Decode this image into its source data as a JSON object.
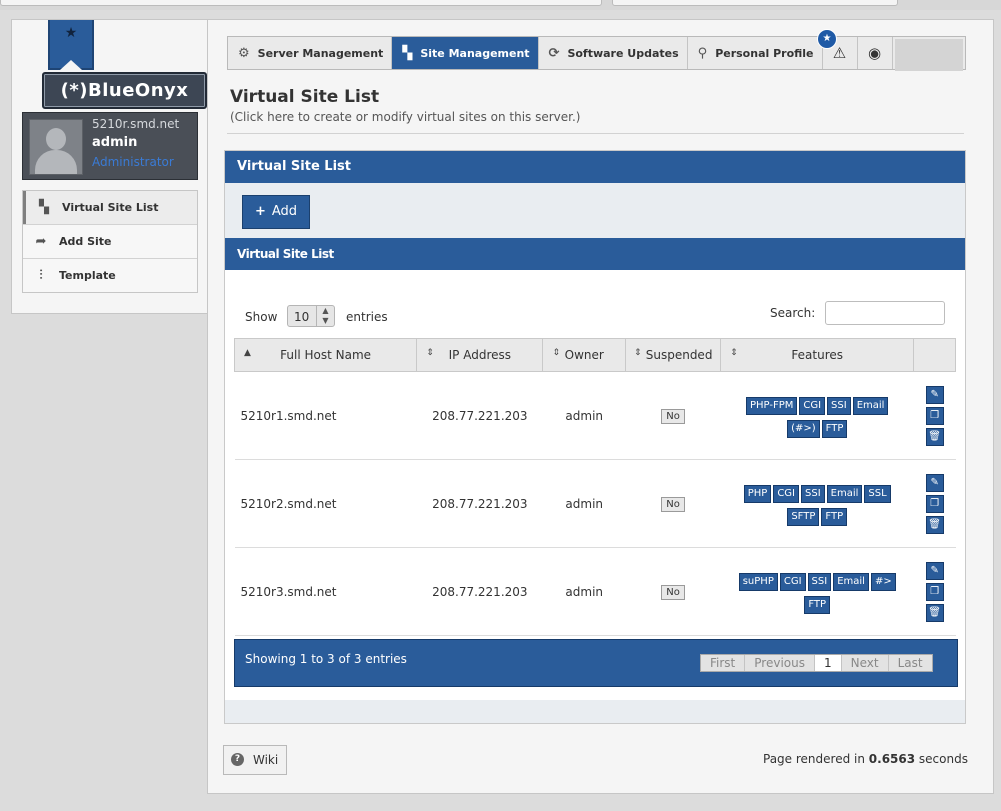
{
  "sidebar": {
    "logo_text": "(*)BlueOnyx",
    "user": {
      "host": "5210r.smd.net",
      "name": "admin",
      "role": "Administrator"
    },
    "items": [
      {
        "label": "Virtual Site List",
        "icon": "layout-icon"
      },
      {
        "label": "Add Site",
        "icon": "share-arrow-icon"
      },
      {
        "label": "Template",
        "icon": "sliders-icon"
      }
    ]
  },
  "tabs": [
    {
      "label": "Server Management",
      "icon": "gear-icon"
    },
    {
      "label": "Site Management",
      "icon": "layout-icon",
      "active": true
    },
    {
      "label": "Software Updates",
      "icon": "refresh-icon"
    },
    {
      "label": "Personal Profile",
      "icon": "user-icon"
    }
  ],
  "page": {
    "title": "Virtual Site List",
    "subtitle": "(Click here to create or modify virtual sites on this server.)"
  },
  "block": {
    "header": "Virtual Site List",
    "add_label": "Add",
    "subheader": "Virtual Site List"
  },
  "table": {
    "show_label": "Show",
    "page_size": "10",
    "entries_label": "entries",
    "search_label": "Search:",
    "columns": [
      "Full Host Name",
      "IP Address",
      "Owner",
      "Suspended",
      "Features"
    ],
    "rows": [
      {
        "host": "5210r1.smd.net",
        "ip": "208.77.221.203",
        "owner": "admin",
        "suspended": "No",
        "features": [
          "PHP-FPM",
          "CGI",
          "SSI",
          "Email",
          "(#>)",
          "FTP"
        ]
      },
      {
        "host": "5210r2.smd.net",
        "ip": "208.77.221.203",
        "owner": "admin",
        "suspended": "No",
        "features": [
          "PHP",
          "CGI",
          "SSI",
          "Email",
          "SSL",
          "SFTP",
          "FTP"
        ]
      },
      {
        "host": "5210r3.smd.net",
        "ip": "208.77.221.203",
        "owner": "admin",
        "suspended": "No",
        "features": [
          "suPHP",
          "CGI",
          "SSI",
          "Email",
          "#>",
          "FTP"
        ]
      }
    ],
    "info": "Showing 1 to 3 of 3 entries",
    "pager": {
      "first": "First",
      "previous": "Previous",
      "current": "1",
      "next": "Next",
      "last": "Last"
    }
  },
  "footer": {
    "wiki_label": "Wiki",
    "rendered_prefix": "Page rendered in",
    "rendered_time": "0.6563",
    "rendered_suffix": "seconds"
  },
  "colors": {
    "accent": "#2a5c9a",
    "accent_dark": "#163a69",
    "role": "#3a7bd5"
  }
}
